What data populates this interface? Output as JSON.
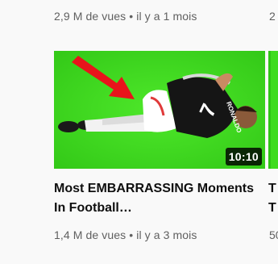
{
  "prev_row": {
    "views": "2,9 M de vues",
    "separator": "•",
    "age": "il y a 1 mois",
    "next_clip": "2"
  },
  "video": {
    "duration": "10:10",
    "title": "Most EMBARRASSING Moments In Football…",
    "views": "1,4 M de vues",
    "separator": "•",
    "age": "il y a 3 mois",
    "jersey_text": "RONALDO",
    "jersey_number": "7"
  },
  "next_peek": {
    "title_line1": "T",
    "title_line2": "T",
    "views_clip": "50"
  },
  "colors": {
    "grass": "#3fdc1e",
    "arrow": "#e8141b",
    "background": "#f9f9f9"
  }
}
